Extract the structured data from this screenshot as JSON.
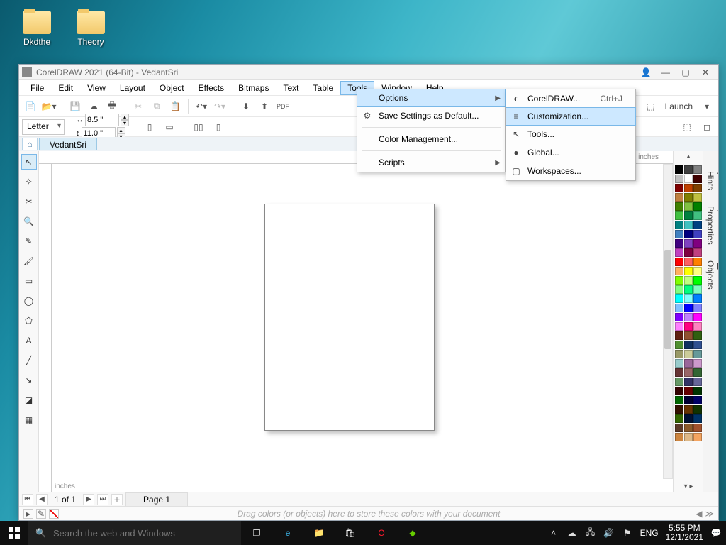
{
  "desktop": {
    "icons": [
      "Dkdthe",
      "Theory"
    ]
  },
  "window": {
    "title": "CorelDRAW 2021 (64-Bit) - VedantSri",
    "menus": [
      "File",
      "Edit",
      "View",
      "Layout",
      "Object",
      "Effects",
      "Bitmaps",
      "Text",
      "Table",
      "Tools",
      "Window",
      "Help"
    ],
    "active_menu": "Tools",
    "launch": "Launch",
    "paper": "Letter",
    "width": "8.5 \"",
    "height": "11.0 \"",
    "doc_tab": "VedantSri",
    "units": "inches",
    "page_of": "1 of 1",
    "page_tab": "Page 1",
    "colorstore_hint": "Drag colors (or objects) here to store these colors with your document",
    "panel_tabs": [
      "Hints",
      "Properties",
      "Objects"
    ]
  },
  "tools_menu": {
    "options": "Options",
    "save_settings": "Save Settings as Default...",
    "color_mgmt": "Color Management...",
    "scripts": "Scripts"
  },
  "options_submenu": {
    "coreldraw": "CorelDRAW...",
    "coreldraw_kb": "Ctrl+J",
    "customization": "Customization...",
    "tools": "Tools...",
    "global": "Global...",
    "workspaces": "Workspaces..."
  },
  "palette": [
    "#000000",
    "#404040",
    "#808080",
    "#C0C0C0",
    "#FFFFFF",
    "#400000",
    "#800000",
    "#C04000",
    "#804000",
    "#C08040",
    "#808000",
    "#C0C040",
    "#408000",
    "#80C040",
    "#008000",
    "#40C040",
    "#008040",
    "#40C080",
    "#008080",
    "#40C0C0",
    "#004080",
    "#4080C0",
    "#000080",
    "#4040C0",
    "#400080",
    "#8040C0",
    "#800080",
    "#C040C0",
    "#800040",
    "#C04080",
    "#FF0000",
    "#FF6060",
    "#FF8000",
    "#FFB060",
    "#FFFF00",
    "#FFFF80",
    "#80FF00",
    "#C0FF80",
    "#00FF00",
    "#80FF80",
    "#00FF80",
    "#80FFC0",
    "#00FFFF",
    "#80FFFF",
    "#0080FF",
    "#80C0FF",
    "#0000FF",
    "#8080FF",
    "#8000FF",
    "#C080FF",
    "#FF00FF",
    "#FF80FF",
    "#FF0080",
    "#FF80C0",
    "#602010",
    "#905030",
    "#306010",
    "#509030",
    "#103060",
    "#305090",
    "#999966",
    "#CCCC99",
    "#669999",
    "#99CCCC",
    "#996699",
    "#CC99CC",
    "#663333",
    "#996666",
    "#336633",
    "#669966",
    "#333366",
    "#666699",
    "#330000",
    "#660000",
    "#003300",
    "#006600",
    "#000033",
    "#000066",
    "#331100",
    "#663300",
    "#113300",
    "#336600",
    "#001133",
    "#003366",
    "#5b3a29",
    "#8b5a2b",
    "#a0522d",
    "#cd853f",
    "#deb887",
    "#f4a460"
  ],
  "taskbar": {
    "search_placeholder": "Search the web and Windows",
    "lang": "ENG",
    "time": "5:55 PM",
    "date": "12/1/2021"
  }
}
